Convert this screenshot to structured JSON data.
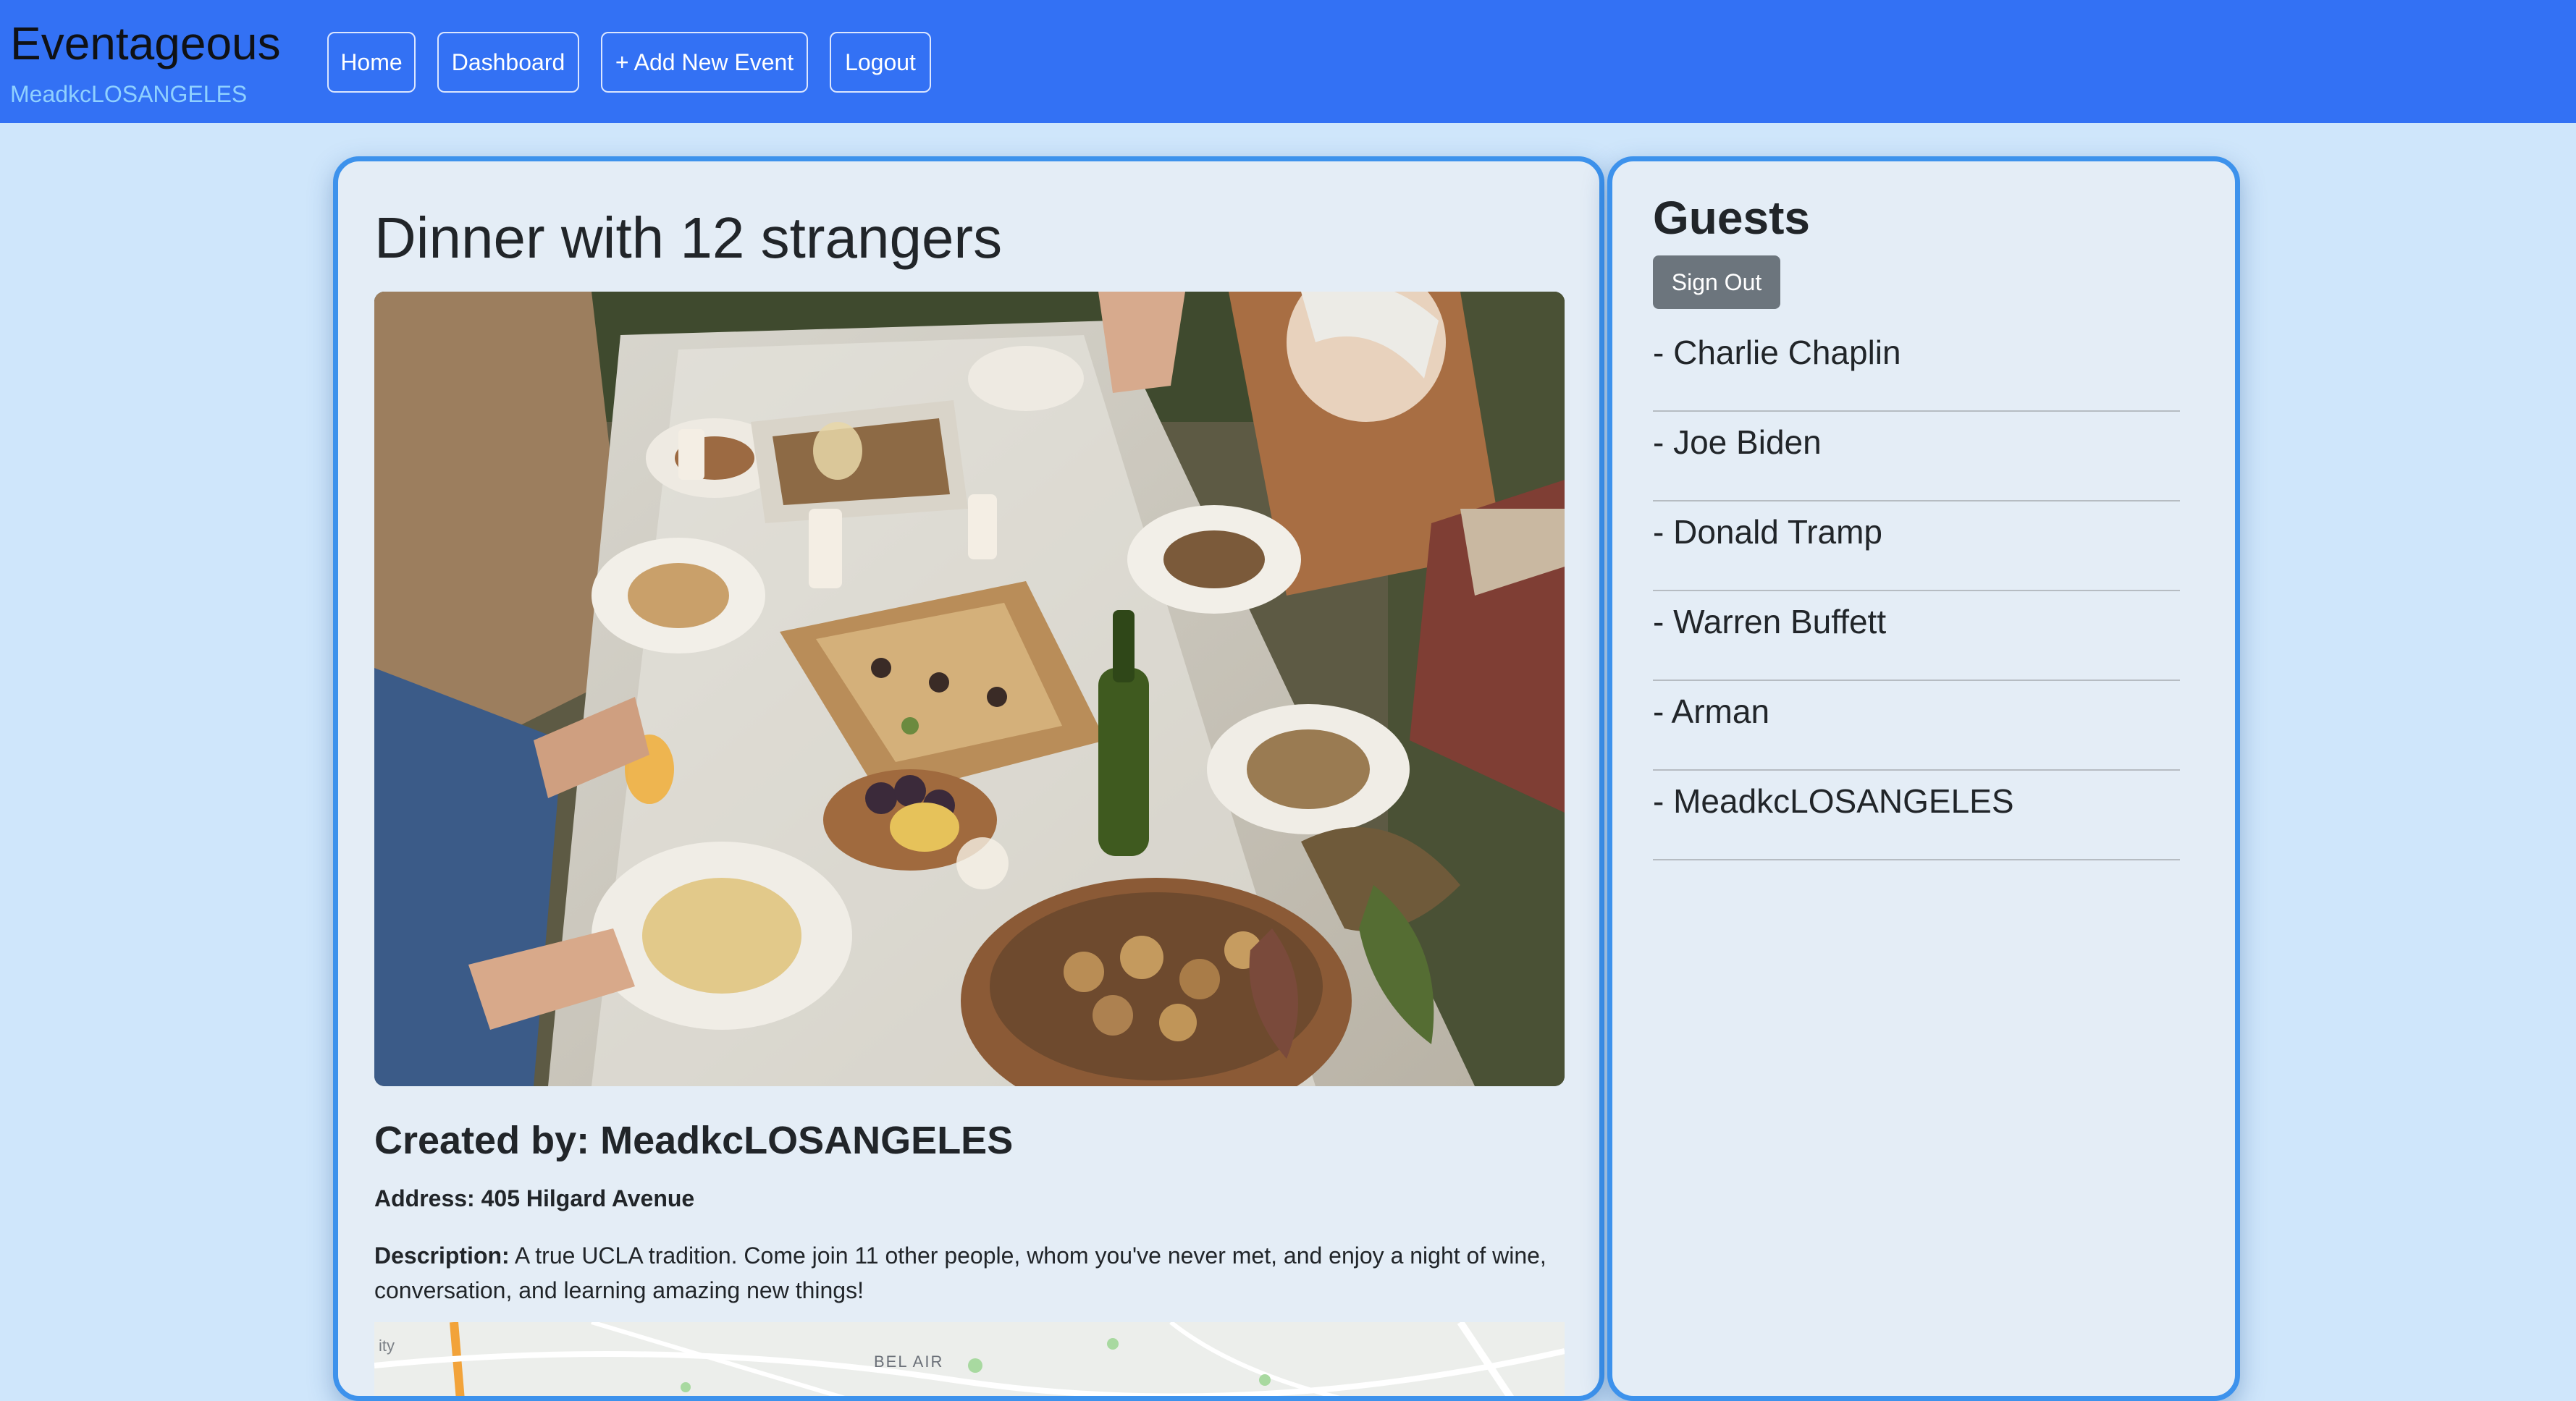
{
  "navbar": {
    "brand": "Eventageous",
    "username": "MeadkcLOSANGELES",
    "buttons": [
      "Home",
      "Dashboard",
      "+ Add New Event",
      "Logout"
    ],
    "color": "#3371f4"
  },
  "event": {
    "title": "Dinner with 12 strangers",
    "created_by": "Created by: MeadkcLOSANGELES",
    "address": "Address: 405 Hilgard Avenue",
    "description_label": "Description:",
    "description_text": " A true UCLA tradition. Come join 11 other people, whom you've never met, and enjoy a night of wine, conversation, and learning amazing new things!",
    "map_label": "BEL AIR",
    "map_partial_label": "ity"
  },
  "guests": {
    "title": "Guests",
    "sign_out": "Sign Out",
    "list": [
      "- Charlie Chaplin",
      "- Joe Biden",
      "- Donald Tramp",
      "- Warren Buffett",
      "- Arman",
      "- MeadkcLOSANGELES"
    ]
  },
  "colors": {
    "background": "#cfe6fb",
    "card_border": "#3d92ec",
    "card_bg": "#e4edf6",
    "button_secondary": "#6c757d"
  }
}
